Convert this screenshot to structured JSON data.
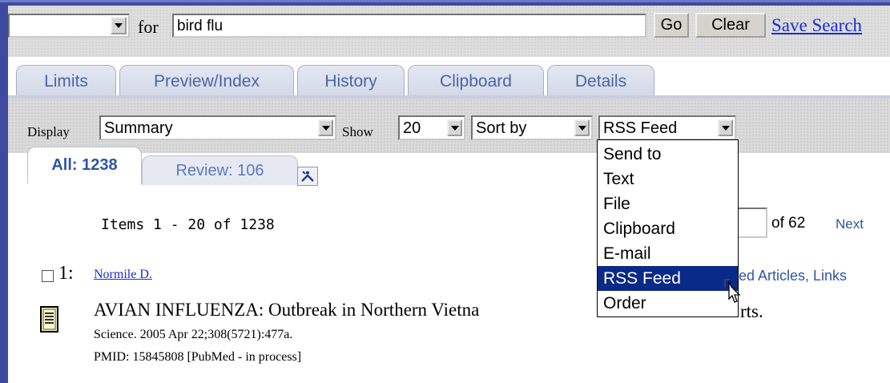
{
  "search": {
    "for_label": "for",
    "query": "bird flu",
    "go_label": "Go",
    "clear_label": "Clear",
    "save_search_label": "Save Search"
  },
  "tabs": [
    {
      "label": "Limits"
    },
    {
      "label": "Preview/Index"
    },
    {
      "label": "History"
    },
    {
      "label": "Clipboard"
    },
    {
      "label": "Details"
    }
  ],
  "display_bar": {
    "display_label": "Display",
    "display_value": "Summary",
    "show_label": "Show",
    "show_value": "20",
    "sort_value": "Sort by",
    "sendto_value": "RSS Feed"
  },
  "sendto_menu": {
    "options": [
      "Send to",
      "Text",
      "File",
      "Clipboard",
      "E-mail",
      "RSS Feed",
      "Order"
    ],
    "selected": "RSS Feed"
  },
  "subtabs": [
    {
      "label": "All: 1238"
    },
    {
      "label": "Review: 106"
    }
  ],
  "results": {
    "items_text": "Items 1 - 20 of 1238",
    "of_text": "of 62",
    "next_label": "Next",
    "item": {
      "number": "1:",
      "author": "Normile D.",
      "related_text": "ed Articles, Links",
      "title": "AVIAN INFLUENZA: Outbreak in Northern Vietna",
      "title_tail": "rts.",
      "citation": "Science. 2005 Apr 22;308(5721):477a.",
      "pmid": "PMID: 15845808 [PubMed - in process]"
    }
  },
  "colors": {
    "frame": "#3d4aa0",
    "link": "#1b2bd0",
    "tab_text": "#4a66a6",
    "menu_highlight": "#0a2a88"
  },
  "icons": [
    "chevron-down-icon",
    "tools-icon",
    "document-icon",
    "mouse-cursor-icon"
  ]
}
